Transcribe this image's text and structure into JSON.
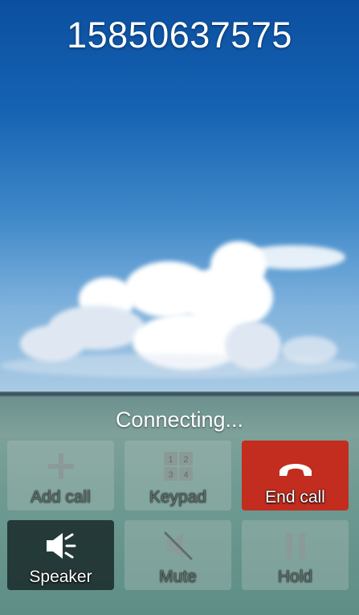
{
  "call": {
    "phone_number": "15850637575",
    "status": "Connecting..."
  },
  "buttons": {
    "add_call": {
      "label": "Add call",
      "icon": "plus-icon",
      "enabled": false
    },
    "keypad": {
      "label": "Keypad",
      "icon": "keypad-icon",
      "keys": [
        "1",
        "2",
        "3",
        "4"
      ],
      "enabled": false
    },
    "end_call": {
      "label": "End call",
      "icon": "hang-up-icon",
      "enabled": true
    },
    "speaker": {
      "label": "Speaker",
      "icon": "speaker-icon",
      "enabled": true
    },
    "mute": {
      "label": "Mute",
      "icon": "mute-icon",
      "enabled": false
    },
    "hold": {
      "label": "Hold",
      "icon": "pause-icon",
      "enabled": false
    }
  },
  "colors": {
    "end_call": "#c22d1f",
    "text": "#ffffff",
    "disabled_text": "#5f6e6a"
  }
}
